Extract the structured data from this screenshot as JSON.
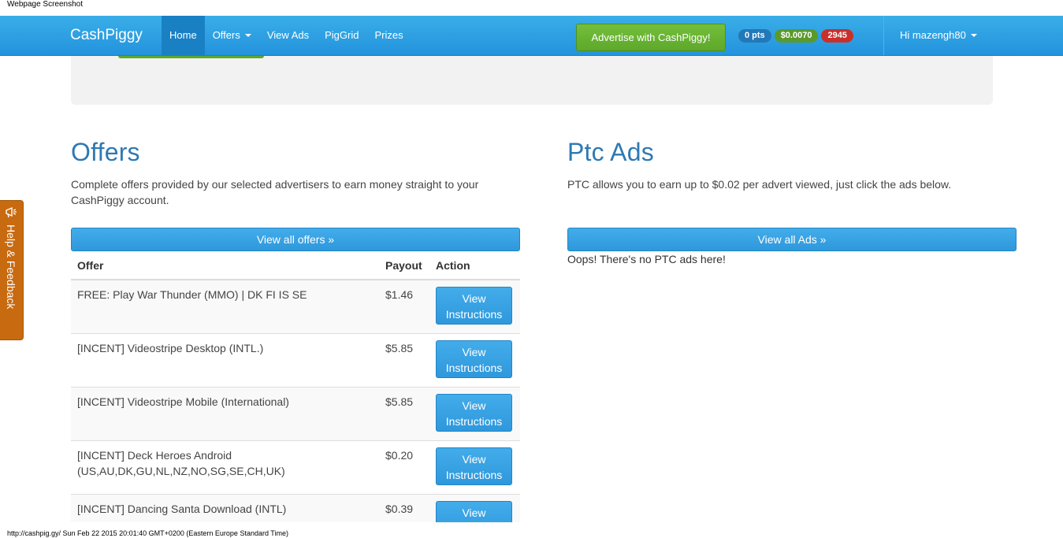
{
  "capture": {
    "title": "Webpage Screenshot",
    "footer": "http://cashpig.gy/ Sun Feb 22 2015 20:01:40 GMT+0200 (Eastern Europe Standard Time)"
  },
  "navbar": {
    "brand": "CashPiggy",
    "items": [
      {
        "label": "Home",
        "active": true,
        "dropdown": false
      },
      {
        "label": "Offers",
        "active": false,
        "dropdown": true
      },
      {
        "label": "View Ads",
        "active": false,
        "dropdown": false
      },
      {
        "label": "PigGrid",
        "active": false,
        "dropdown": false
      },
      {
        "label": "Prizes",
        "active": false,
        "dropdown": false
      }
    ],
    "advertise_label": "Advertise with CashPiggy!",
    "badges": {
      "points": "0 pts",
      "balance": "$0.0070",
      "count": "2945"
    },
    "user_label": "Hi mazengh80"
  },
  "feedback": {
    "label": "Help & Feedback",
    "icon": "megaphone-icon"
  },
  "offers": {
    "title": "Offers",
    "description": "Complete offers provided by our selected advertisers to earn money straight to your CashPiggy account.",
    "view_all_label": "View all offers »",
    "headers": {
      "offer": "Offer",
      "payout": "Payout",
      "action": "Action"
    },
    "rows": [
      {
        "name": "FREE: Play War Thunder (MMO) | DK FI IS SE",
        "payout": "$1.46",
        "action": "View Instructions"
      },
      {
        "name": "[INCENT] Videostripe Desktop (INTL.)",
        "payout": "$5.85",
        "action": "View Instructions"
      },
      {
        "name": "[INCENT] Videostripe Mobile (International)",
        "payout": "$5.85",
        "action": "View Instructions"
      },
      {
        "name": "[INCENT] Deck Heroes Android (US,AU,DK,GU,NL,NZ,NO,SG,SE,CH,UK)",
        "payout": "$0.20",
        "action": "View Instructions"
      },
      {
        "name": "[INCENT] Dancing Santa Download (INTL)",
        "payout": "$0.39",
        "action": "View Instructions"
      }
    ]
  },
  "ptc": {
    "title": "Ptc Ads",
    "description": "PTC allows you to earn up to $0.02 per advert viewed, just click the ads below.",
    "view_all_label": "View all Ads »",
    "empty_message": "Oops! There's no PTC ads here!"
  },
  "colors": {
    "accent": "#2e98dc",
    "heading": "#2e79b3",
    "advertise": "#5ea82b",
    "feedback": "#c86a0f"
  }
}
